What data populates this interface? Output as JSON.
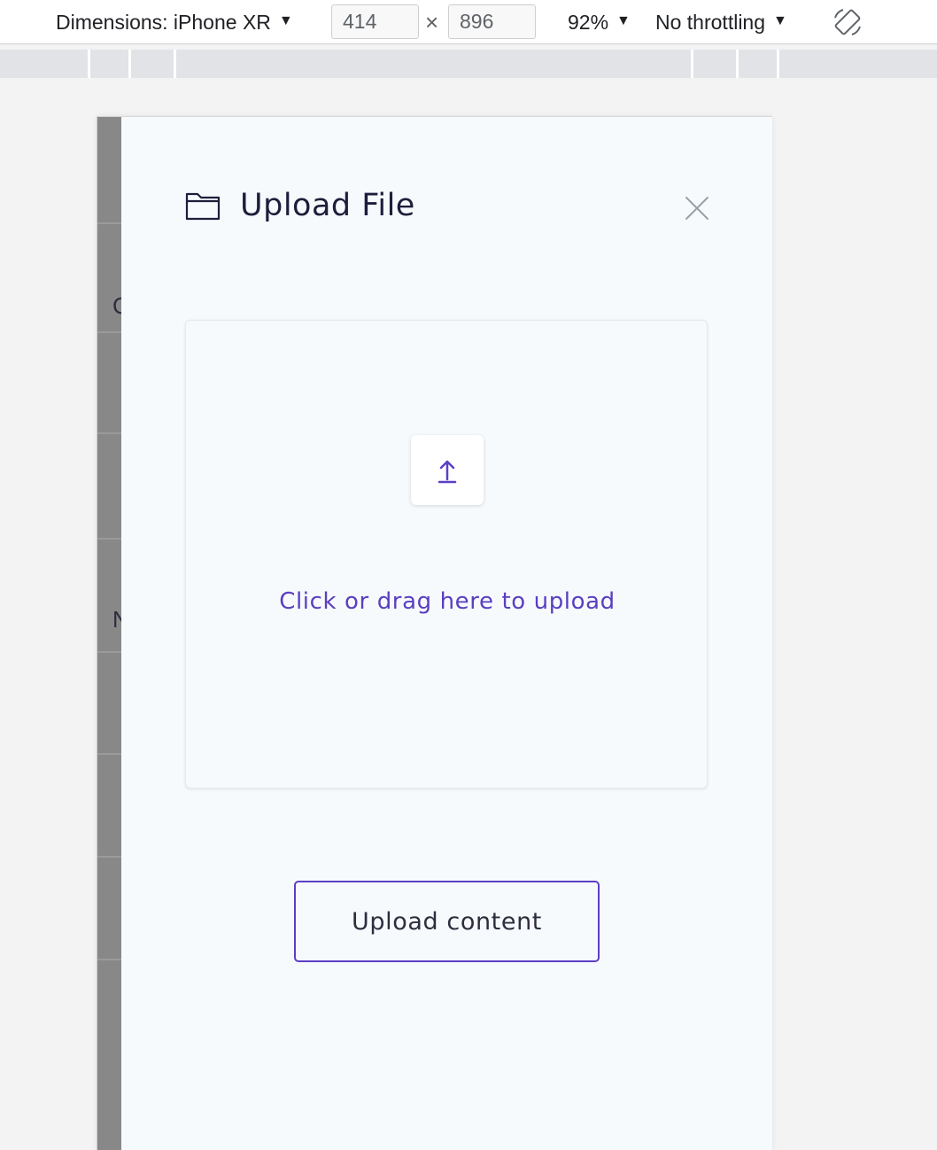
{
  "devtools": {
    "dimensions_label": "Dimensions: iPhone XR",
    "width_value": "414",
    "times_symbol": "×",
    "height_value": "896",
    "zoom": "92%",
    "throttling": "No throttling",
    "caret": "▼"
  },
  "background_letters": [
    "C",
    "N"
  ],
  "modal": {
    "title": "Upload File",
    "drop_text": "Click or drag here to upload",
    "upload_button": "Upload content"
  },
  "colors": {
    "accent": "#5b3fc4",
    "title": "#1f1d3c",
    "panel_bg": "#f7fafc"
  },
  "icons": {
    "folder": "folder-icon",
    "close": "close-icon",
    "upload": "upload-arrow-icon",
    "rotate": "rotate-device-icon"
  }
}
